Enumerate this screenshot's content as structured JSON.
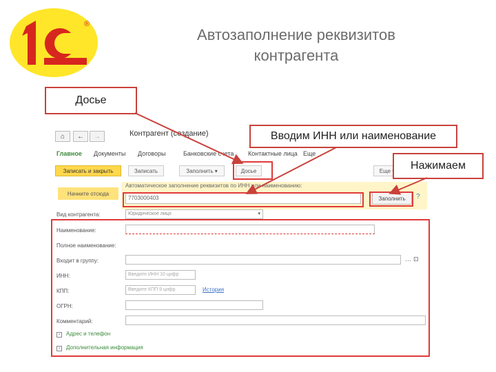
{
  "slide": {
    "title_line1": "Автозаполнение реквизитов",
    "title_line2": "контрагента",
    "logo_text": "1С",
    "logo_mark": "®"
  },
  "callouts": {
    "dosye": "Досье",
    "inn": "Вводим ИНН или наименование",
    "press": "Нажимаем"
  },
  "form": {
    "title": "Контрагент (создание)",
    "nav_tabs": [
      "Главное",
      "Документы",
      "Договоры",
      "Банковские счета",
      "Контактные лица",
      "Еще"
    ],
    "commands": {
      "save_close": "Записать и закрыть",
      "save": "Записать",
      "fill": "Заполнить",
      "dosye": "Досье",
      "more": "Еще"
    },
    "autofill": {
      "start_tag": "Начните отсюда",
      "label": "Автоматическое заполнение реквизитов по ИНН или наименованию:",
      "inn_value": "7703000403",
      "fill_button": "Заполнить",
      "help": "?"
    },
    "fields": {
      "kind_label": "Вид контрагента:",
      "kind_value": "Юридическое лицо",
      "name_label": "Наименование:",
      "full_name_label": "Полное наименование:",
      "group_label": "Входит в группу:",
      "inn_label": "ИНН:",
      "inn_placeholder": "Введите ИНН 10 цифр",
      "kpp_label": "КПП:",
      "kpp_placeholder": "Введите КПП 9 цифр",
      "history_link": "История",
      "ogrn_label": "ОГРН:",
      "comment_label": "Комментарий:"
    },
    "sections": {
      "address": "Адрес и телефон",
      "extra": "Дополнительная информация"
    }
  }
}
